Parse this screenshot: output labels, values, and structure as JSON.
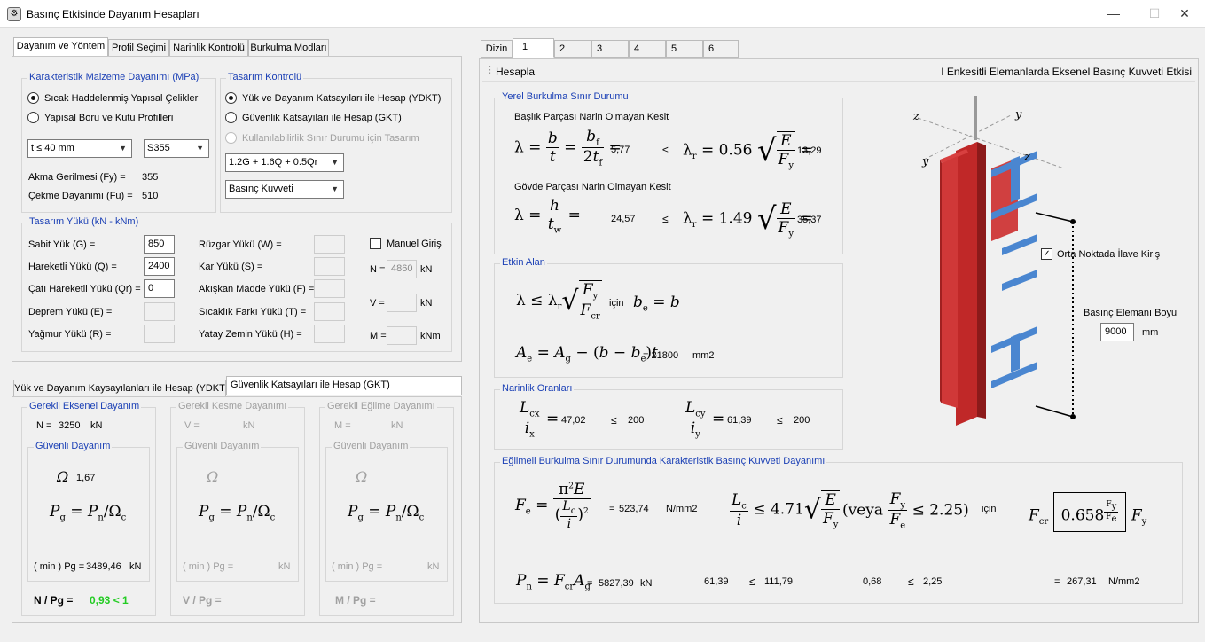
{
  "window": {
    "title": "Basınç Etkisinde Dayanım Hesapları",
    "min": "—",
    "max": "☐",
    "close": "✕"
  },
  "left_tabs": [
    "Dayanım ve Yöntem",
    "Profil Seçimi",
    "Narinlik Kontrolü",
    "Burkulma Modları"
  ],
  "material": {
    "title": "Karakteristik Malzeme Dayanımı (MPa)",
    "opt1": "Sıcak Haddelenmiş Yapısal Çelikler",
    "opt2": "Yapısal Boru ve Kutu Profilleri",
    "thickness": "t ≤ 40 mm",
    "grade": "S355",
    "fy_label": "Akma Gerilmesi (Fy) =",
    "fy": "355",
    "fu_label": "Çekme Dayanımı (Fu) =",
    "fu": "510"
  },
  "design": {
    "title": "Tasarım Kontrolü",
    "opt1": "Yük ve Dayanım Katsayıları ile Hesap (YDKT)",
    "opt2": "Güvenlik Katsayıları ile Hesap (GKT)",
    "opt3": "Kullanılabilirlik Sınır Durumu için Tasarım",
    "combo": "1.2G + 1.6Q + 0.5Qr",
    "force": "Basınç Kuvveti"
  },
  "loads": {
    "title": "Tasarım Yükü (kN - kNm)",
    "G": "Sabit Yük (G) =",
    "G_val": "850",
    "Q": "Hareketli Yükü (Q) =",
    "Q_val": "2400",
    "Qr": "Çatı Hareketli Yükü (Qr) =",
    "Qr_val": "0",
    "E": "Deprem Yükü (E) =",
    "R": "Yağmur Yükü (R) =",
    "W": "Rüzgar Yükü (W) =",
    "S": "Kar Yükü (S) =",
    "F": "Akışkan Madde Yükü (F) =",
    "T": "Sıcaklık Farkı Yükü (T) =",
    "H": "Yatay Zemin Yükü (H) =",
    "manual": "Manuel Giriş",
    "N_lbl": "N =",
    "N_val": "4860",
    "N_unit": "kN",
    "V_lbl": "V =",
    "V_unit": "kN",
    "M_lbl": "M =",
    "M_unit": "kNm"
  },
  "bottom_tabs": [
    "Yük ve Dayanım Kaysayılanları ile Hesap (YDKT)",
    "Güvenlik Katsayıları ile Hesap (GKT)"
  ],
  "axial": {
    "title": "Gerekli Eksenel Dayanım",
    "N_lbl": "N =",
    "N_val": "3250",
    "unit": "kN",
    "safe": "Güvenli Dayanım",
    "omega_val": "1,67",
    "pg_lbl": "( min ) Pg =",
    "pg_val": "3489,46",
    "pg_unit": "kN",
    "ratio_lbl": "N / Pg =",
    "ratio": "0,93 < 1"
  },
  "shear": {
    "title": "Gerekli Kesme Dayanımı",
    "lbl": "V =",
    "unit": "kN",
    "safe": "Güvenli Dayanım",
    "pg_lbl": "( min ) Pg =",
    "pg_unit": "kN",
    "ratio_lbl": "V / Pg ="
  },
  "moment": {
    "title": "Gerekli Eğilme Dayanımı",
    "lbl": "M =",
    "unit": "kN",
    "safe": "Güvenli Dayanım",
    "pg_lbl": "( min ) Pg =",
    "pg_unit": "kN",
    "ratio_lbl": "M / Pg ="
  },
  "right_tabs": [
    "Dizin",
    "1",
    "2",
    "3",
    "4",
    "5",
    "6"
  ],
  "toolbar": {
    "calc": "Hesapla",
    "caption": "I Enkesitli Elemanlarda Eksenel Basınç Kuvveti Etkisi"
  },
  "local": {
    "title": "Yerel Burkulma Sınır Durumu",
    "flange": "Başlık Parçası  Narin Olmayan Kesit",
    "flange_val": "5,77",
    "flange_lim": "13,29",
    "web": "Gövde Parçası  Narin Olmayan Kesit",
    "web_val": "24,57",
    "web_lim": "35,37",
    "le": "≤"
  },
  "effective": {
    "title": "Etkin Alan",
    "icin": "için",
    "area": "= 21800",
    "unit": "mm2"
  },
  "slender": {
    "title": "Narinlik Oranları",
    "x_val": "47,02",
    "x_lim": "200",
    "y_val": "61,39",
    "y_lim": "200",
    "le": "≤"
  },
  "buckling": {
    "title": "Eğilmeli Burkulma Sınır Durumunda Karakteristik Basınç Kuvveti Dayanımı",
    "fe": "523,74",
    "fe_unit": "N/mm2",
    "icin": "için",
    "pn": "5827,39",
    "pn_unit": "kN",
    "v1": "61,39",
    "v1_lim": "111,79",
    "v2": "0,68",
    "v2_lim": "2,25",
    "fcr": "267,31",
    "fcr_unit": "N/mm2",
    "le": "≤",
    "eq": "="
  },
  "figure": {
    "z": "z",
    "y": "y",
    "brace": "Orta Noktada İlave Kiriş",
    "len_lbl": "Basınç Elemanı Boyu",
    "len": "9000",
    "len_unit": "mm"
  },
  "colors": {
    "accent": "#1a3fb5",
    "ok": "#22cc22",
    "column": "#d03030",
    "beam": "#3a78c9"
  }
}
